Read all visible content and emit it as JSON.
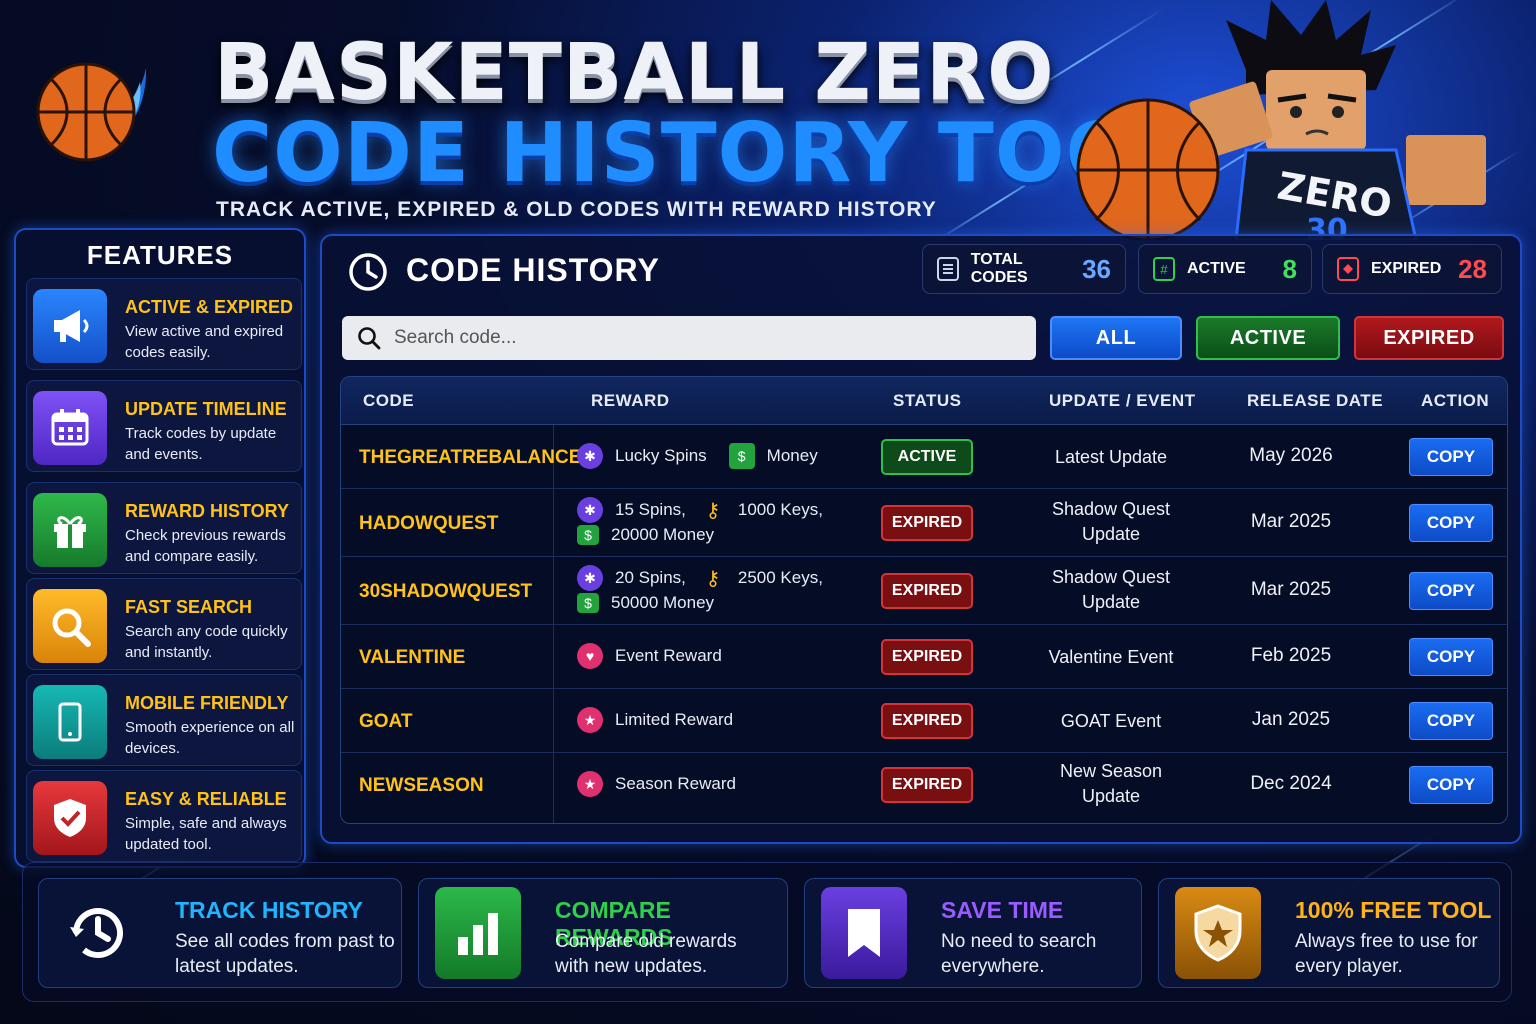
{
  "header": {
    "title_line1": "BASKETBALL ZERO",
    "title_line2": "CODE HISTORY TOOL",
    "tagline": "TRACK ACTIVE, EXPIRED & OLD CODES WITH REWARD HISTORY",
    "jersey_text": "ZERO",
    "jersey_number": "30"
  },
  "features": {
    "heading": "FEATURES",
    "items": [
      {
        "title": "ACTIVE & EXPIRED",
        "desc": "View active and expired codes easily.",
        "icon": "megaphone-icon",
        "color": "#1f6fe6"
      },
      {
        "title": "UPDATE TIMELINE",
        "desc": "Track codes by update and events.",
        "icon": "calendar-icon",
        "color": "#6a3fe0"
      },
      {
        "title": "REWARD HISTORY",
        "desc": "Check previous rewards and compare easily.",
        "icon": "gift-icon",
        "color": "#22a33e"
      },
      {
        "title": "FAST SEARCH",
        "desc": "Search any code quickly and instantly.",
        "icon": "magnifier-icon",
        "color": "#f0a214"
      },
      {
        "title": "MOBILE FRIENDLY",
        "desc": "Smooth experience on all devices.",
        "icon": "phone-icon",
        "color": "#10a3a0"
      },
      {
        "title": "EASY & RELIABLE",
        "desc": "Simple, safe and always updated tool.",
        "icon": "shield-check-icon",
        "color": "#d63034"
      }
    ]
  },
  "panel": {
    "title": "CODE HISTORY",
    "stats": {
      "total_label": "TOTAL CODES",
      "total_value": "36",
      "active_label": "ACTIVE",
      "active_value": "8",
      "expired_label": "EXPIRED",
      "expired_value": "28"
    },
    "search_placeholder": "Search code...",
    "filters": {
      "all": "ALL",
      "active": "ACTIVE",
      "expired": "EXPIRED"
    },
    "columns": {
      "code": "CODE",
      "reward": "REWARD",
      "status": "STATUS",
      "event": "UPDATE / EVENT",
      "date": "RELEASE DATE",
      "action": "ACTION"
    },
    "rows": [
      {
        "code": "THEGREATREBALANCE",
        "reward_a": "Lucky Spins",
        "reward_b": "Money",
        "status": "ACTIVE",
        "event": "Latest Update",
        "date": "May 2026",
        "action": "COPY"
      },
      {
        "code": "HADOWQUEST",
        "reward_a": "15 Spins,",
        "reward_b": "1000 Keys,",
        "reward_c": "20000 Money",
        "status": "EXPIRED",
        "event": "Shadow Quest Update",
        "date": "Mar 2025",
        "action": "COPY"
      },
      {
        "code": "30SHADOWQUEST",
        "reward_a": "20 Spins,",
        "reward_b": "2500 Keys,",
        "reward_c": "50000 Money",
        "status": "EXPIRED",
        "event": "Shadow Quest Update",
        "date": "Mar 2025",
        "action": "COPY"
      },
      {
        "code": "VALENTINE",
        "reward_a": "Event Reward",
        "status": "EXPIRED",
        "event": "Valentine Event",
        "date": "Feb 2025",
        "action": "COPY"
      },
      {
        "code": "GOAT",
        "reward_a": "Limited Reward",
        "status": "EXPIRED",
        "event": "GOAT Event",
        "date": "Jan 2025",
        "action": "COPY"
      },
      {
        "code": "NEWSEASON",
        "reward_a": "Season Reward",
        "status": "EXPIRED",
        "event": "New Season Update",
        "date": "Dec 2024",
        "action": "COPY"
      }
    ]
  },
  "bottom": [
    {
      "title": "TRACK HISTORY",
      "desc": "See all codes from past to latest updates.",
      "color": "#1fb6ff",
      "icon": "history-clock-icon"
    },
    {
      "title": "COMPARE REWARDS",
      "desc": "Compare old rewards with new updates.",
      "color": "#2fd14a",
      "icon": "bar-chart-icon"
    },
    {
      "title": "SAVE TIME",
      "desc": "No need to search everywhere.",
      "color": "#9b5cff",
      "icon": "bookmark-icon"
    },
    {
      "title": "100% FREE TOOL",
      "desc": "Always free to use for every player.",
      "color": "#ffb21a",
      "icon": "star-shield-icon"
    }
  ]
}
